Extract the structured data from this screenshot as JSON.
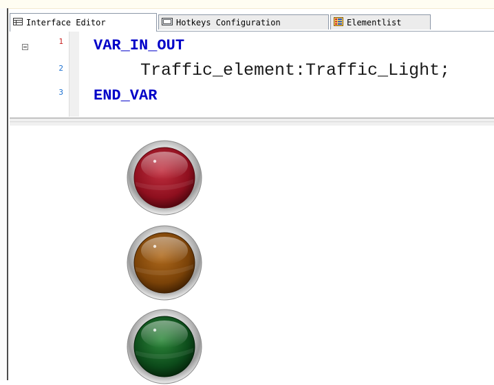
{
  "tabs": [
    {
      "label": "Interface Editor",
      "icon": "table-icon",
      "active": true
    },
    {
      "label": "Hotkeys Configuration",
      "icon": "keyboard-icon",
      "active": false
    },
    {
      "label": "Elementlist",
      "icon": "list-grid-icon",
      "active": false
    }
  ],
  "editor": {
    "line_numbers": [
      "1",
      "2",
      "3"
    ],
    "lines": [
      {
        "kind": "keyword",
        "text": "VAR_IN_OUT"
      },
      {
        "kind": "declaration",
        "text": "Traffic_element:Traffic_Light;"
      },
      {
        "kind": "keyword",
        "text": "END_VAR"
      }
    ]
  },
  "lights": [
    {
      "name": "red",
      "color": "#8e0f1e"
    },
    {
      "name": "yellow",
      "color": "#7a4208"
    },
    {
      "name": "green",
      "color": "#0c4a1a"
    }
  ],
  "colors": {
    "keyword": "#0000c8",
    "line_number_first": "#c81e1e",
    "line_number": "#1a6fd0"
  }
}
